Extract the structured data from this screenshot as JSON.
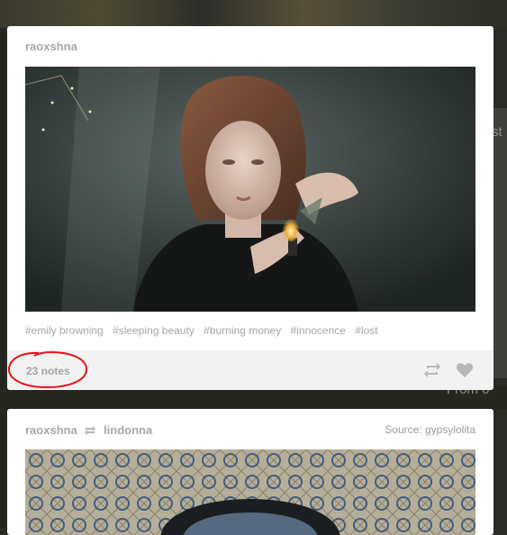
{
  "background": {
    "right_text_1": "st",
    "right_text_2": "From o"
  },
  "posts": [
    {
      "author": "raoxshna",
      "tags": [
        "#emily browning",
        "#sleeping beauty",
        "#burning money",
        "#innocence",
        "#lost"
      ],
      "notes": "23 notes",
      "actions": {
        "reblog_icon": "reblog-icon",
        "like_icon": "heart-icon"
      }
    },
    {
      "author": "raoxshna",
      "reblogged_from": "lindonna",
      "source": "Source: gypsylolita"
    }
  ],
  "colors": {
    "annotation": "#e3121b",
    "card": "#ffffff",
    "footer": "#f2f2f2",
    "muted_text": "#a7a7a7"
  }
}
